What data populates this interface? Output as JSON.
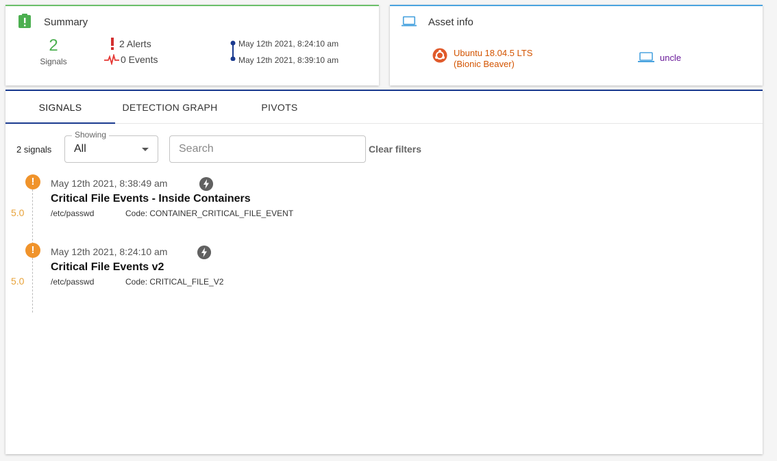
{
  "summary": {
    "title": "Summary",
    "signals_count": "2",
    "signals_label": "Signals",
    "alerts": "2 Alerts",
    "events": "0 Events",
    "time_start": "May 12th 2021, 8:24:10 am",
    "time_end": "May 12th 2021, 8:39:10 am",
    "accent_color": "#6abf69"
  },
  "asset": {
    "title": "Asset info",
    "os_line1": "Ubuntu 18.04.5 LTS",
    "os_line2": "(Bionic Beaver)",
    "hostname": "uncle",
    "accent_color": "#4aa3df"
  },
  "tabs": [
    {
      "label": "SIGNALS",
      "active": true
    },
    {
      "label": "DETECTION GRAPH",
      "active": false
    },
    {
      "label": "PIVOTS",
      "active": false
    }
  ],
  "filters": {
    "count_label": "2 signals",
    "showing_legend": "Showing",
    "showing_value": "All",
    "search_placeholder": "Search",
    "clear_label": "Clear filters"
  },
  "signals": [
    {
      "time": "May 12th 2021, 8:38:49 am",
      "title": "Critical File Events - Inside Containers",
      "path": "/etc/passwd",
      "code": "Code: CONTAINER_CRITICAL_FILE_EVENT",
      "score": "5.0",
      "icon": "lightning-icon"
    },
    {
      "time": "May 12th 2021, 8:24:10 am",
      "title": "Critical File Events v2",
      "path": "/etc/passwd",
      "code": "Code: CRITICAL_FILE_V2",
      "score": "5.0",
      "icon": "lightning-icon"
    }
  ]
}
